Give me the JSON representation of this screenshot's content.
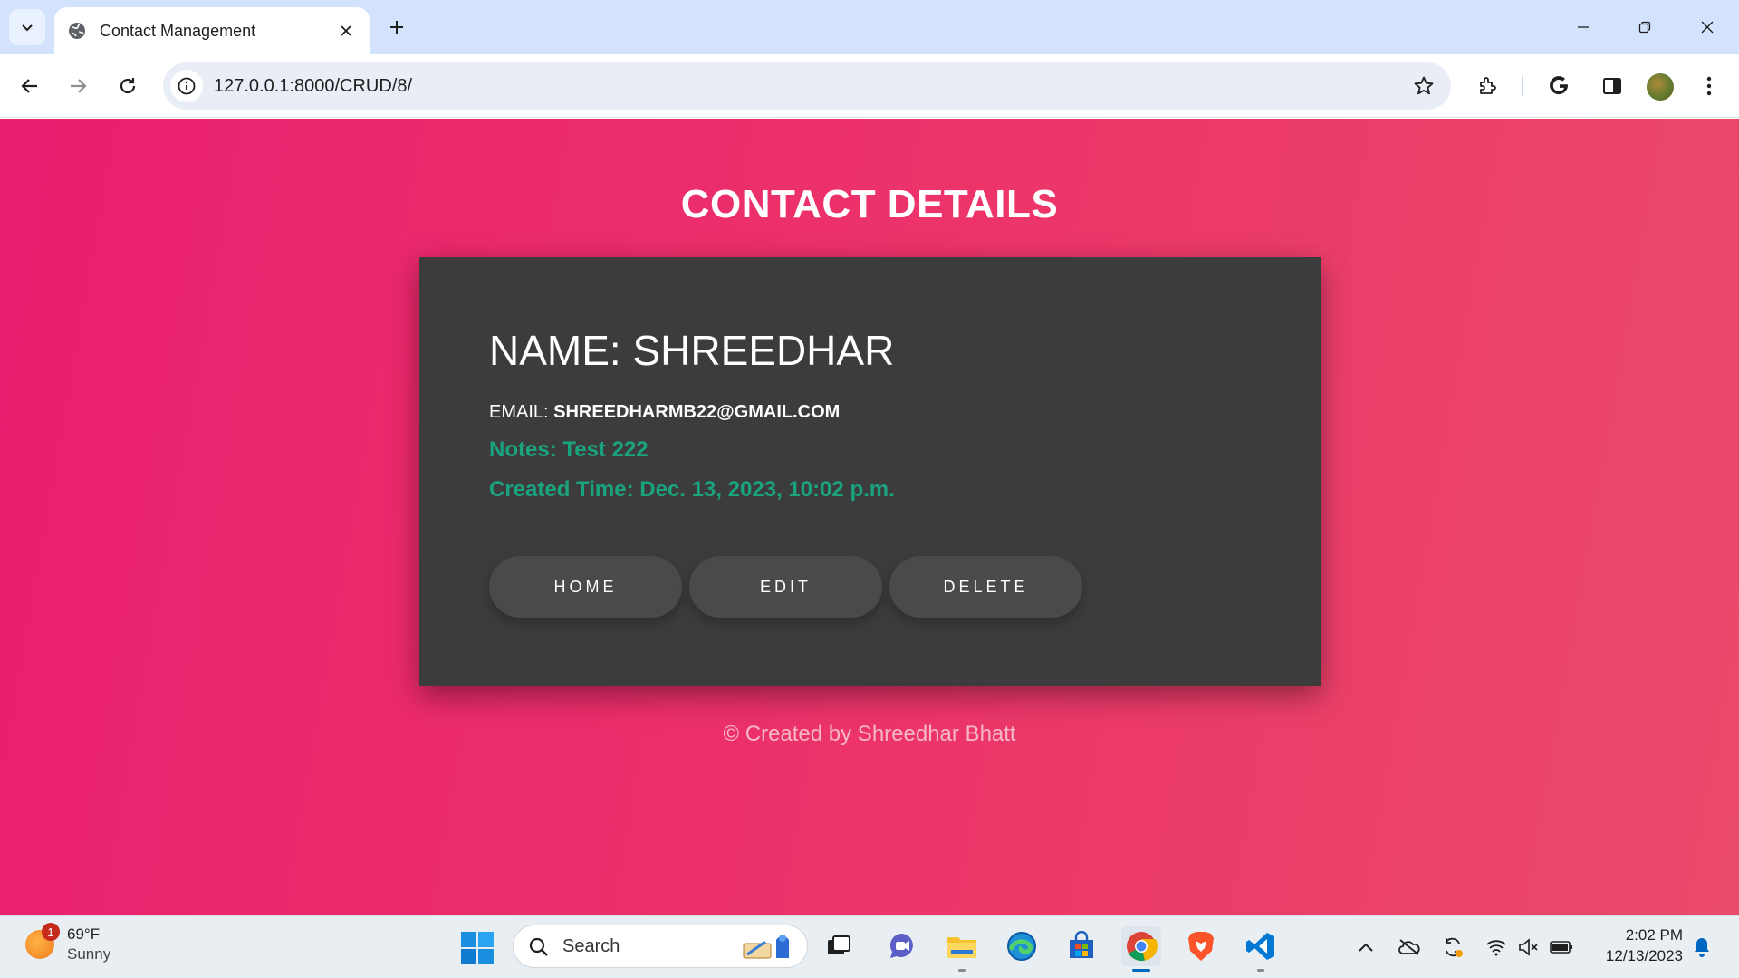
{
  "browser": {
    "tab_title": "Contact Management",
    "url": "127.0.0.1:8000/CRUD/8/"
  },
  "page": {
    "title": "CONTACT DETAILS",
    "name_label": "NAME: SHREEDHAR",
    "email_label": "EMAIL:",
    "email_value": "SHREEDHARMB22@GMAIL.COM",
    "notes": "Notes: Test 222",
    "created_time": "Created Time: Dec. 13, 2023, 10:02 p.m.",
    "buttons": {
      "home": "HOME",
      "edit": "EDIT",
      "delete": "DELETE"
    },
    "footer": "© Created by Shreedhar Bhatt"
  },
  "taskbar": {
    "weather_temp": "69°F",
    "weather_cond": "Sunny",
    "weather_badge": "1",
    "search_placeholder": "Search",
    "time": "2:02 PM",
    "date": "12/13/2023"
  },
  "colors": {
    "page_gradient_start": "#e91e6f",
    "page_gradient_end": "#ea4a6a",
    "card_bg": "#3c3c3c",
    "accent_green": "#1aa37f"
  }
}
